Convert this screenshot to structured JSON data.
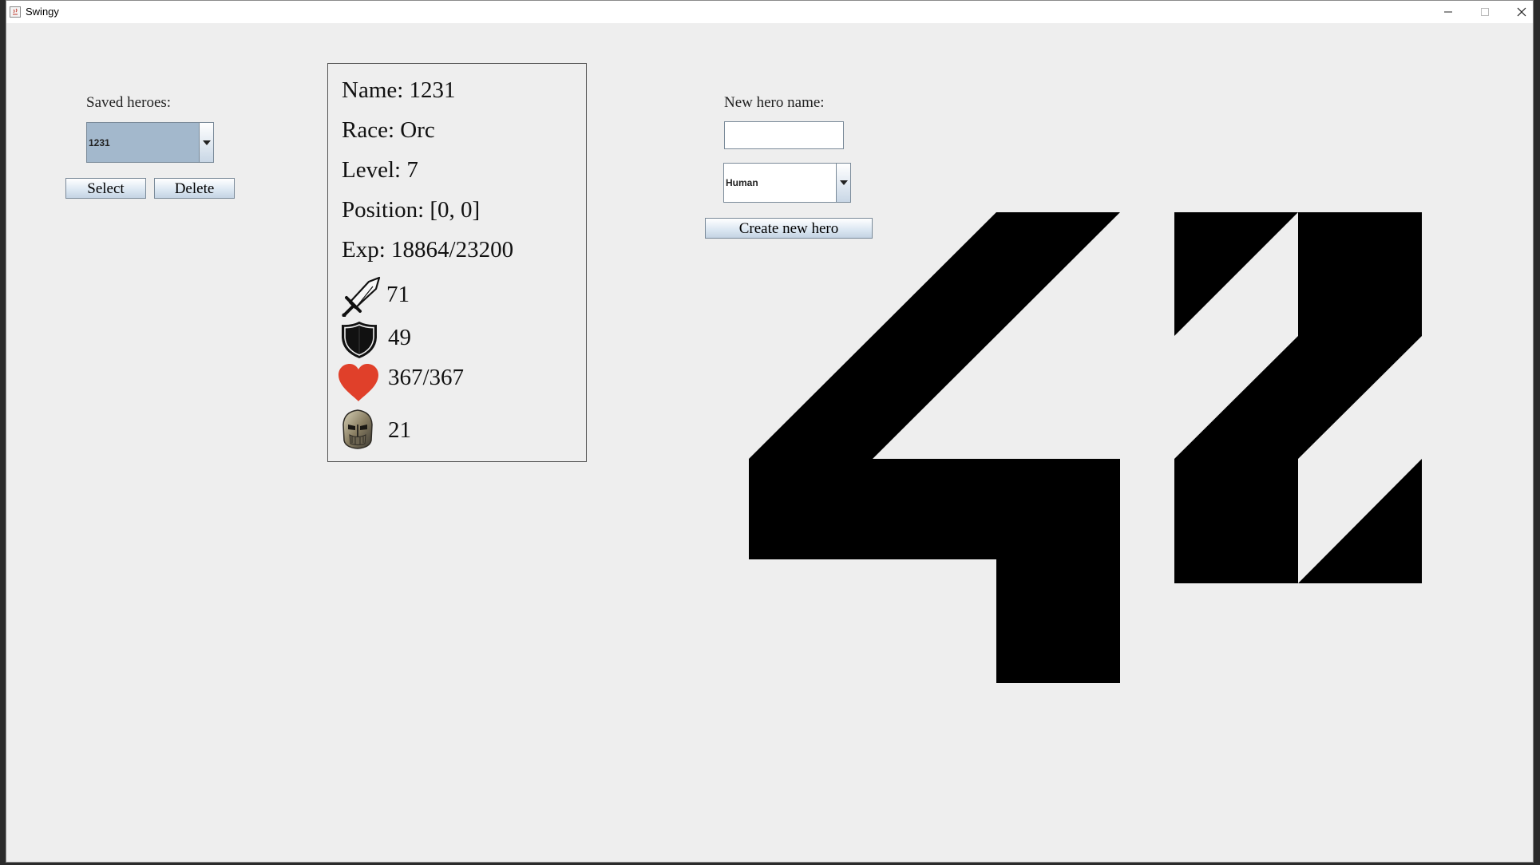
{
  "window": {
    "title": "Swingy"
  },
  "left": {
    "saved_label": "Saved heroes:",
    "saved_selected": "1231",
    "select_label": "Select",
    "delete_label": "Delete"
  },
  "hero": {
    "name_line": "Name: 1231",
    "race_line": "Race: Orc",
    "level_line": "Level: 7",
    "position_line": "Position: [0, 0]",
    "exp_line": "Exp: 18864/23200",
    "attack": "71",
    "defense": "49",
    "hp": "367/367",
    "helm": "21",
    "icons": [
      "sword-icon",
      "shield-icon",
      "heart-icon",
      "helmet-icon"
    ]
  },
  "create": {
    "new_name_label": "New hero name:",
    "new_name_value": "",
    "race_selected": "Human",
    "create_label": "Create new hero"
  },
  "colors": {
    "heart": "#e0402a",
    "combo_selected": "#a3b8cc",
    "window_bg": "#eeeeee"
  }
}
